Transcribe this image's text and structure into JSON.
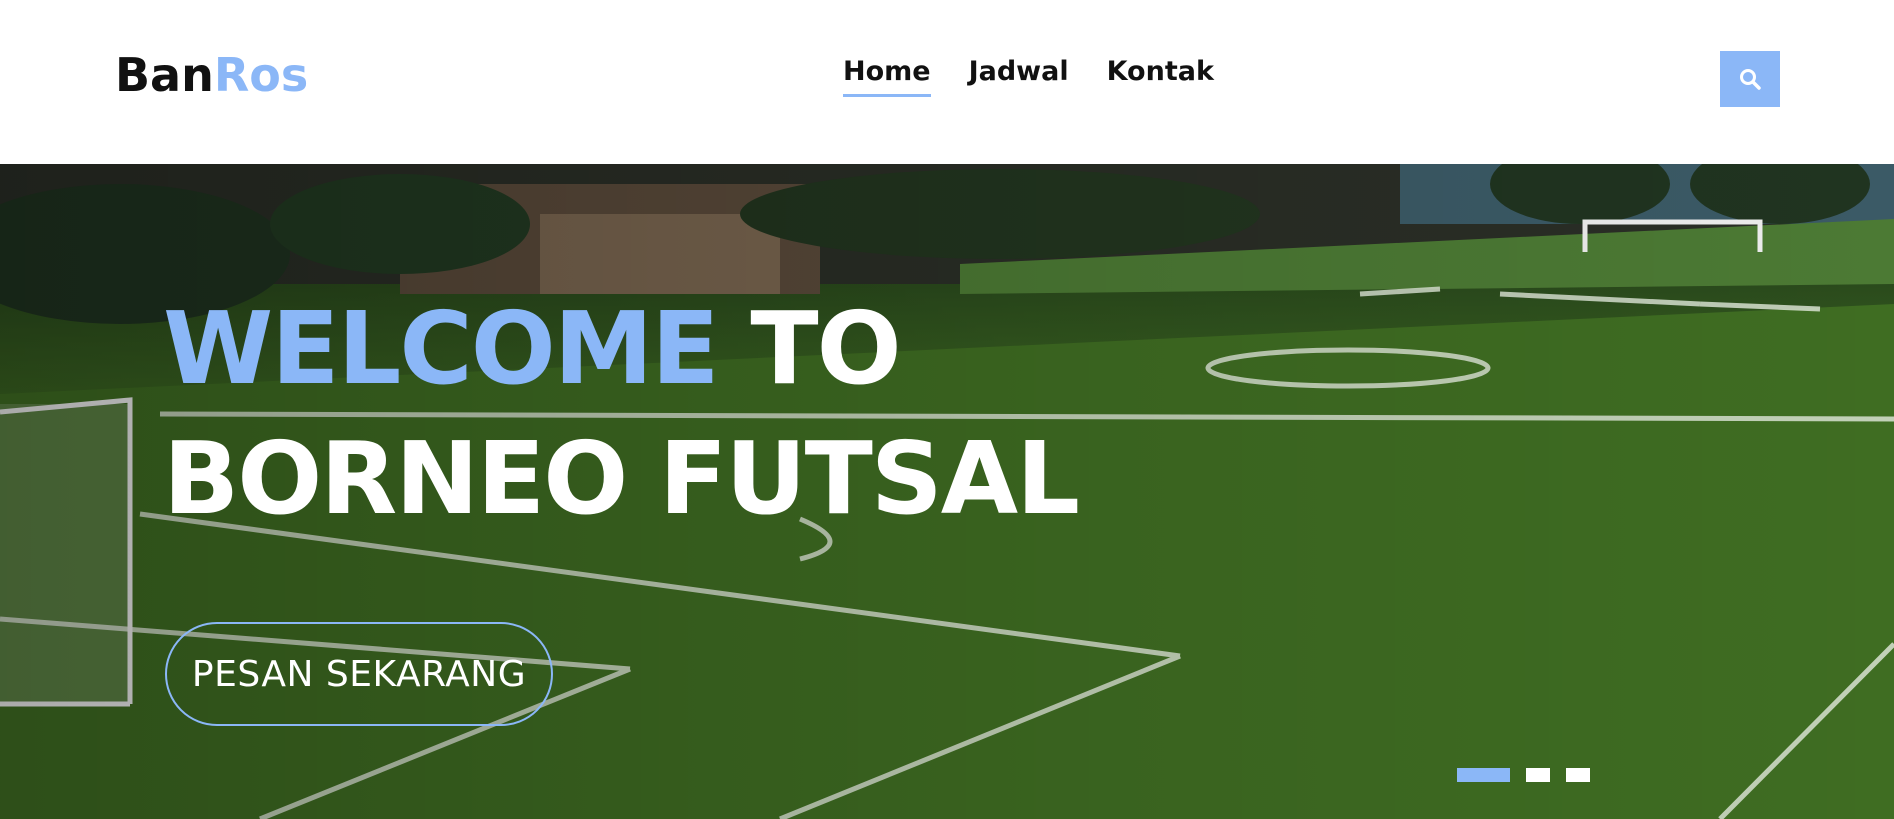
{
  "brand": {
    "part1": "Ban",
    "part2": "Ros"
  },
  "nav": {
    "items": [
      {
        "label": "Home"
      },
      {
        "label": "Jadwal"
      },
      {
        "label": "Kontak"
      }
    ]
  },
  "search": {
    "icon": "search-icon"
  },
  "hero": {
    "headline_accent": "WELCOME",
    "headline_rest": " TO",
    "headline_line2": "BORNEO FUTSAL",
    "cta_label": "PESAN SEKARANG",
    "slide_count": 3,
    "active_slide": 1
  },
  "colors": {
    "accent": "#8bb7f7",
    "text": "#111111",
    "white": "#ffffff"
  }
}
